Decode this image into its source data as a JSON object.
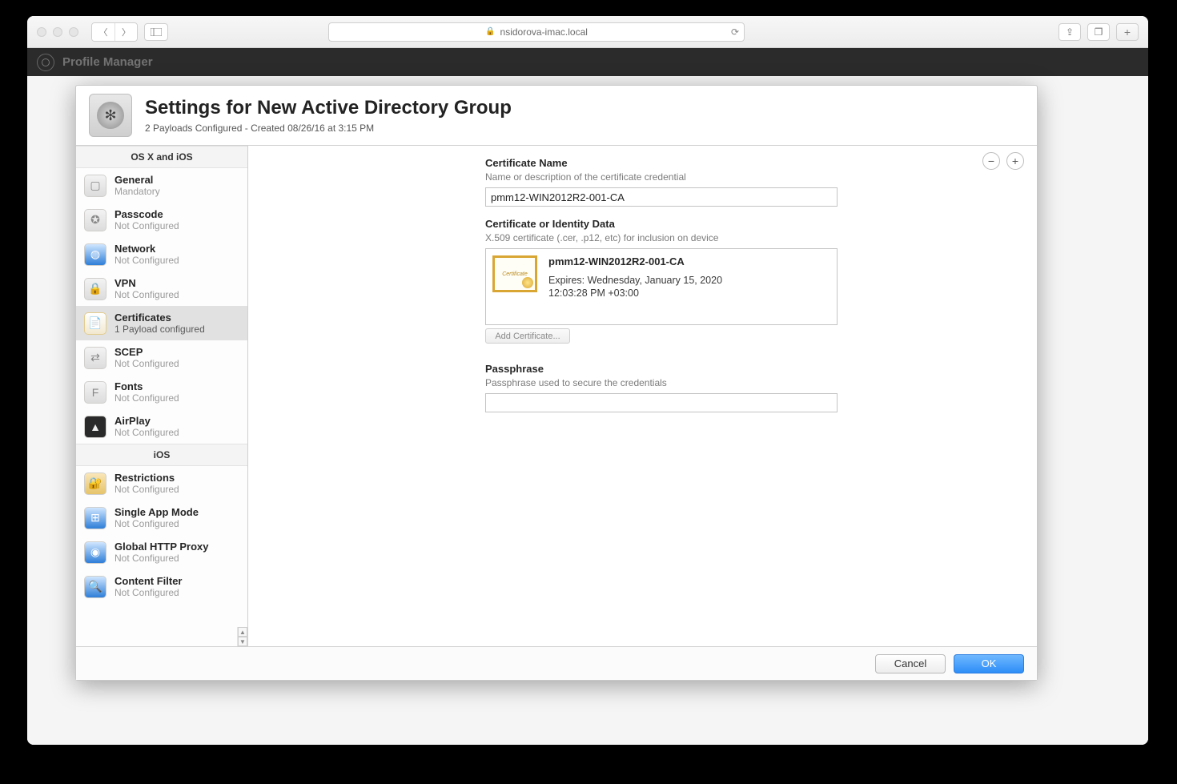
{
  "browser": {
    "url_host": "nsidorova-imac.local"
  },
  "appbar": {
    "title": "Profile Manager"
  },
  "modal": {
    "title": "Settings for New Active Directory Group",
    "subtitle": "2 Payloads Configured - Created 08/26/16 at 3:15 PM"
  },
  "sidebar": {
    "section1": "OS X and iOS",
    "section2": "iOS",
    "osx_items": [
      {
        "title": "General",
        "sub": "Mandatory"
      },
      {
        "title": "Passcode",
        "sub": "Not Configured"
      },
      {
        "title": "Network",
        "sub": "Not Configured"
      },
      {
        "title": "VPN",
        "sub": "Not Configured"
      },
      {
        "title": "Certificates",
        "sub": "1 Payload configured"
      },
      {
        "title": "SCEP",
        "sub": "Not Configured"
      },
      {
        "title": "Fonts",
        "sub": "Not Configured"
      },
      {
        "title": "AirPlay",
        "sub": "Not Configured"
      }
    ],
    "ios_items": [
      {
        "title": "Restrictions",
        "sub": "Not Configured"
      },
      {
        "title": "Single App Mode",
        "sub": "Not Configured"
      },
      {
        "title": "Global HTTP Proxy",
        "sub": "Not Configured"
      },
      {
        "title": "Content Filter",
        "sub": "Not Configured"
      }
    ]
  },
  "cert": {
    "name_label": "Certificate Name",
    "name_hint": "Name or description of the certificate credential",
    "name_value": "pmm12-WIN2012R2-001-CA",
    "data_label": "Certificate or Identity Data",
    "data_hint": "X.509 certificate (.cer, .p12, etc) for inclusion on device",
    "cert_name": "pmm12-WIN2012R2-001-CA",
    "cert_exp1": "Expires: Wednesday, January 15, 2020",
    "cert_exp2": "12:03:28 PM +03:00",
    "add_label": "Add Certificate...",
    "pass_label": "Passphrase",
    "pass_hint": "Passphrase used to secure the credentials"
  },
  "footer": {
    "cancel": "Cancel",
    "ok": "OK"
  }
}
